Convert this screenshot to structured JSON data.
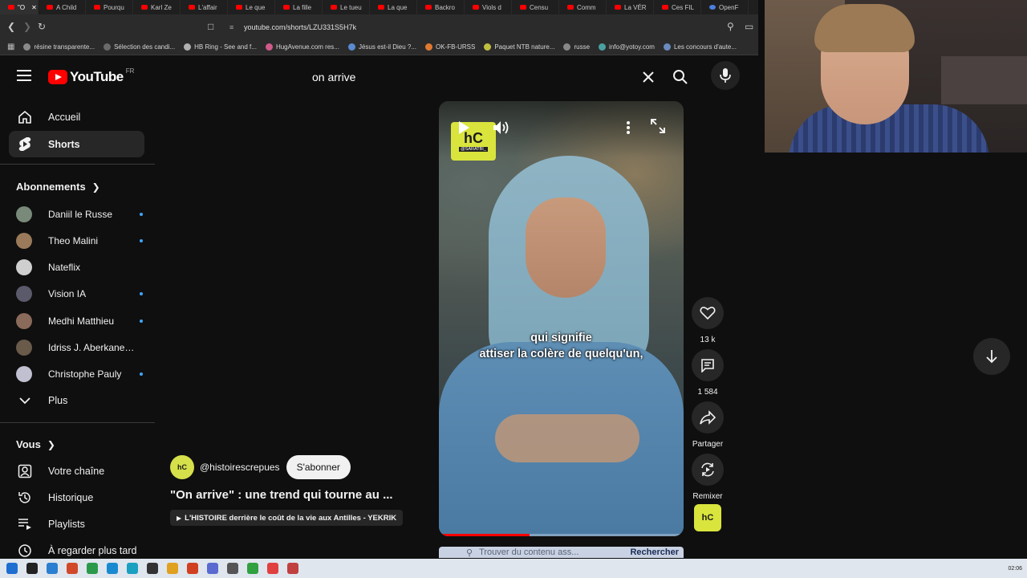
{
  "browser": {
    "tabs": [
      "\"O",
      "A Child",
      "Pourqu",
      "Karl Ze",
      "L'affair",
      "Le que",
      "La fille",
      "Le tueu",
      "La que",
      "Backro",
      "Viols d",
      "Censu",
      "Comm",
      "La VÉR",
      "Ces FIL",
      "OpenF"
    ],
    "url": "youtube.com/shorts/LZU331S5H7k",
    "bookmarks": [
      "résine transparente...",
      "Sélection des candi...",
      "HB Ring - See and f...",
      "HugAvenue.com res...",
      "Jésus est-il Dieu ?...",
      "OK-FB-URSS",
      "Paquet NTB nature...",
      "russe",
      "info@yotoy.com",
      "Les concours d'aute..."
    ]
  },
  "header": {
    "logo_text": "YouTube",
    "country_code": "FR",
    "search_value": "on arrive"
  },
  "sidebar": {
    "primary": [
      {
        "label": "Accueil",
        "icon": "home-icon"
      },
      {
        "label": "Shorts",
        "icon": "shorts-icon"
      }
    ],
    "subscriptions_heading": "Abonnements",
    "subscriptions": [
      {
        "name": "Daniil le Russe",
        "new": true,
        "color": "#7a8a7a"
      },
      {
        "name": "Theo Malini",
        "new": true,
        "color": "#9a7a5a"
      },
      {
        "name": "Nateflix",
        "new": false,
        "color": "#cfcfcf"
      },
      {
        "name": "Vision IA",
        "new": true,
        "color": "#5a5a6a"
      },
      {
        "name": "Medhi Matthieu",
        "new": true,
        "color": "#8a6a5a"
      },
      {
        "name": "Idriss J. Aberkane, ...",
        "new": false,
        "color": "#6a5a4a"
      },
      {
        "name": "Christophe Pauly",
        "new": true,
        "color": "#c0c0d0"
      }
    ],
    "more_label": "Plus",
    "you_heading": "Vous",
    "you_items": [
      {
        "label": "Votre chaîne",
        "icon": "channel-icon"
      },
      {
        "label": "Historique",
        "icon": "history-icon"
      },
      {
        "label": "Playlists",
        "icon": "playlists-icon"
      },
      {
        "label": "À regarder plus tard",
        "icon": "watch-later-icon"
      }
    ]
  },
  "short": {
    "channel_handle": "@histoirescrepues",
    "subscribe_label": "S'abonner",
    "title": "\"On arrive\" : une trend qui tourne au ...",
    "related_video": "L'HISTOIRE derrière le coût de la vie aux Antilles - YEKRIK",
    "caption_line1": "qui signifie",
    "caption_line2": "attiser la colère de quelqu'un,",
    "watermark_tag": "@SARATBI_",
    "progress": 0.37
  },
  "actions": {
    "likes": "13 k",
    "comments": "1 584",
    "share_label": "Partager",
    "remix_label": "Remixer"
  },
  "find_bar": {
    "placeholder": "Trouver du contenu ass...",
    "button": "Rechercher"
  },
  "taskbar": {
    "clock": "02:06"
  },
  "colors": {
    "youtube_red": "#ff0000",
    "channel_yellow": "#d9e43d",
    "new_dot": "#3ea6ff"
  }
}
